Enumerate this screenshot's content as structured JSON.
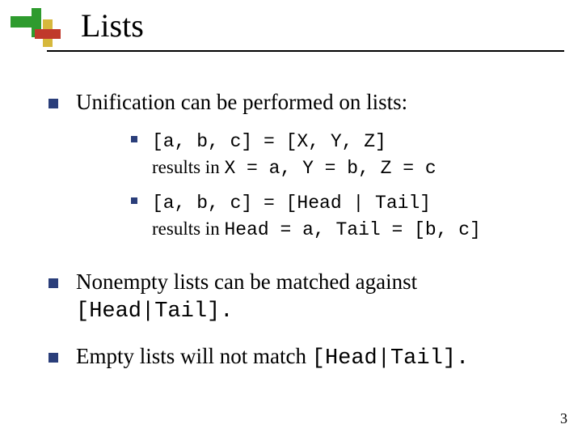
{
  "title": "Lists",
  "bullets": [
    {
      "text": "Unification can be performed on lists:",
      "sub": [
        {
          "code": "[a, b, c] = [X, Y, Z]",
          "result_prefix": "results in ",
          "result_code": "X = a, Y = b, Z = c"
        },
        {
          "code": "[a, b, c] = [Head | Tail]",
          "result_prefix": "results in  ",
          "result_code": "Head = a, Tail = [b, c]"
        }
      ]
    },
    {
      "text_a": "Nonempty lists can be matched against ",
      "code_a": "[Head|Tail]."
    },
    {
      "text_a": "Empty lists will not match ",
      "code_a": "[Head|Tail]."
    }
  ],
  "slide_number": "3"
}
